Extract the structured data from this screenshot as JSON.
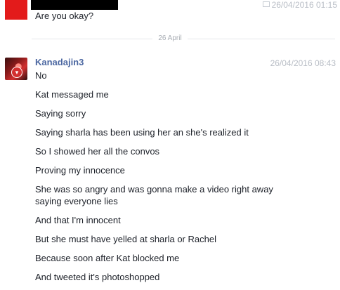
{
  "top_message": {
    "timestamp": "26/04/2016 01:15",
    "text": "Are you okay?"
  },
  "date_divider": "26 April",
  "conversation": {
    "sender": "Kanadajin3",
    "timestamp": "26/04/2016 08:43",
    "messages": [
      "No",
      "Kat messaged me",
      "Saying sorry",
      "Saying sharla has been using her an she's realized it",
      "So I showed her all the convos",
      "Proving my innocence",
      "She was so angry and was gonna make a video right away saying everyone lies",
      "And that I'm innocent",
      "But she must have yelled at sharla or Rachel",
      "Because soon after Kat blocked me",
      "And tweeted it's photoshopped"
    ]
  },
  "colors": {
    "sender_name": "#4b67a1",
    "timestamp": "#b9bec6",
    "avatar_red": "#e31b1b"
  }
}
